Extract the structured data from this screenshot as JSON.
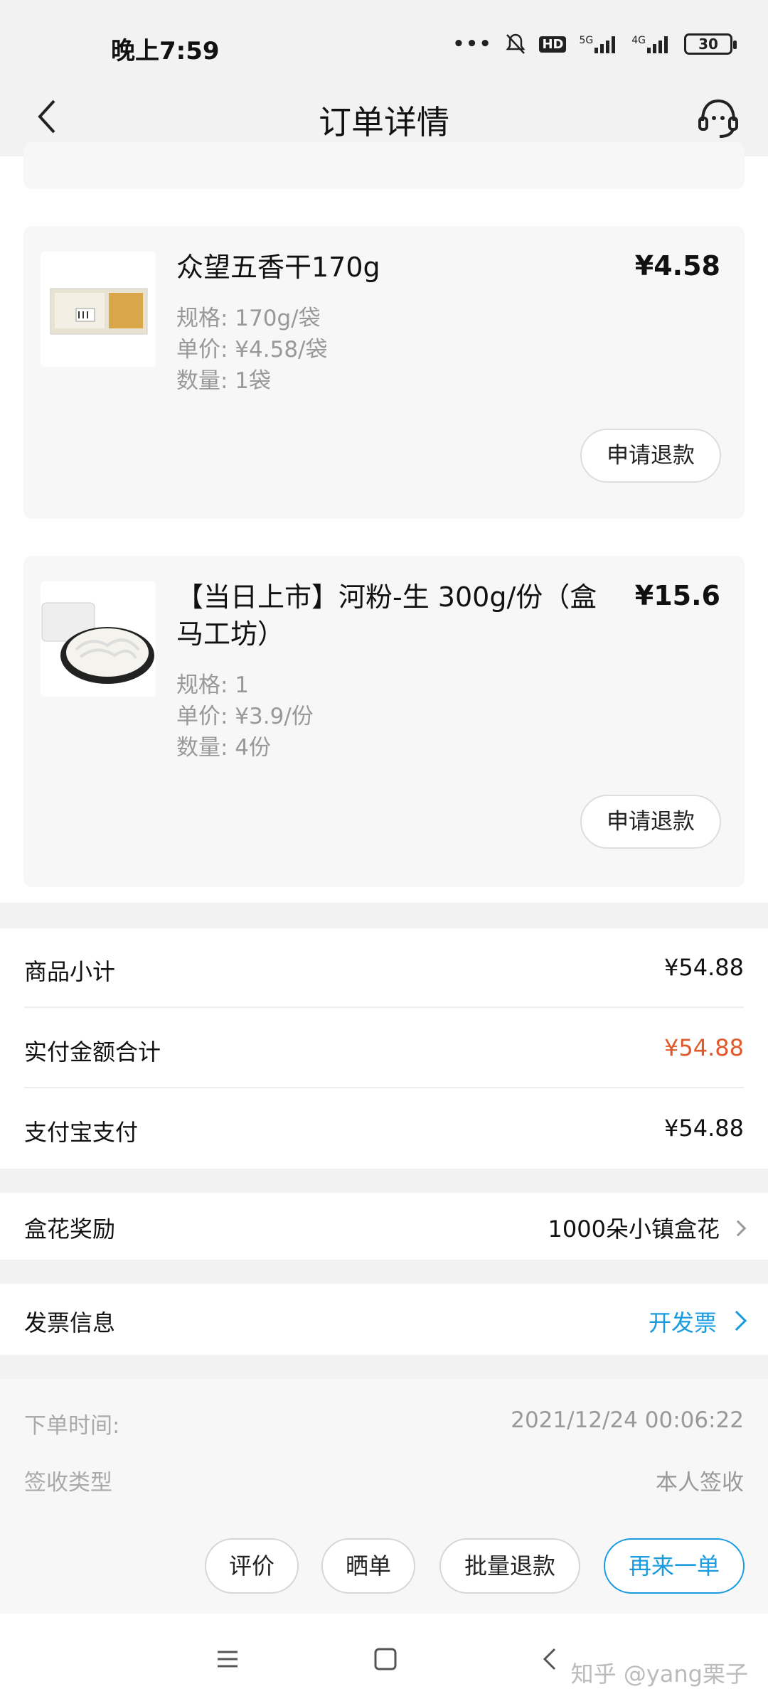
{
  "status_bar": {
    "time": "晚上7:59",
    "network_5g": "5G",
    "network_4g": "4G",
    "hd": "HD",
    "battery": "30"
  },
  "header": {
    "title": "订单详情"
  },
  "products": [
    {
      "name": "众望五香干170g",
      "price": "¥4.58",
      "spec": "规格: 170g/袋",
      "unit_price": "单价: ¥4.58/袋",
      "quantity": "数量: 1袋",
      "refund_label": "申请退款"
    },
    {
      "name": "【当日上市】河粉-生 300g/份（盒马工坊）",
      "price": "¥15.6",
      "spec": "规格: 1",
      "unit_price": "单价: ¥3.9/份",
      "quantity": "数量: 4份",
      "refund_label": "申请退款"
    }
  ],
  "summary": {
    "subtotal_label": "商品小计",
    "subtotal_value": "¥54.88",
    "paid_label": "实付金额合计",
    "paid_value": "¥54.88",
    "alipay_label": "支付宝支付",
    "alipay_value": "¥54.88"
  },
  "reward": {
    "label": "盒花奖励",
    "value": "1000朵小镇盒花"
  },
  "invoice": {
    "label": "发票信息",
    "action": "开发票"
  },
  "order_info": {
    "time_label": "下单时间:",
    "time_value": "2021/12/24 00:06:22",
    "receipt_label": "签收类型",
    "receipt_value": "本人签收"
  },
  "actions": {
    "review": "评价",
    "share": "晒单",
    "batch_refund": "批量退款",
    "reorder": "再来一单"
  },
  "watermark": "知乎 @yang栗子",
  "colors": {
    "accent_blue": "#1a9be0",
    "price_red": "#e0592b"
  }
}
